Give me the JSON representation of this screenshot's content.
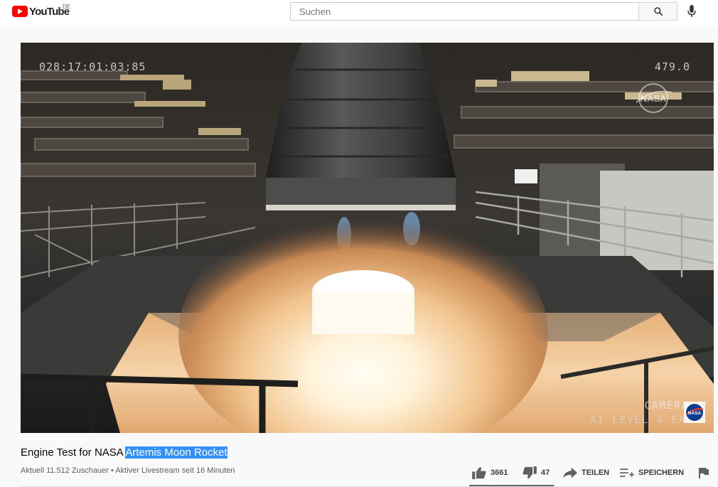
{
  "header": {
    "logo_text": "YouTube",
    "country_code": "DE",
    "search_placeholder": "Suchen",
    "search_icon": "search-icon",
    "mic_icon": "microphone-icon"
  },
  "player": {
    "timecode": "028:17:01:03:85",
    "frame_value": "479.0",
    "camera_label": "CAMERA 4",
    "level_label": "A1 LEVEL 4 EAS",
    "watermark": "NASA"
  },
  "video": {
    "title_plain": "Engine Test for NASA ",
    "title_selected": "Artemis Moon Rocket",
    "meta": "Aktuell 11.512 Zuschauer • Aktiver Livestream seit 16 Minuten"
  },
  "actions": {
    "likes": "3661",
    "dislikes": "47",
    "share_label": "TEILEN",
    "save_label": "SPEICHERN",
    "like_ratio": 0.987
  },
  "colors": {
    "brand_red": "#ff0000",
    "selection_blue": "#3390ff"
  }
}
